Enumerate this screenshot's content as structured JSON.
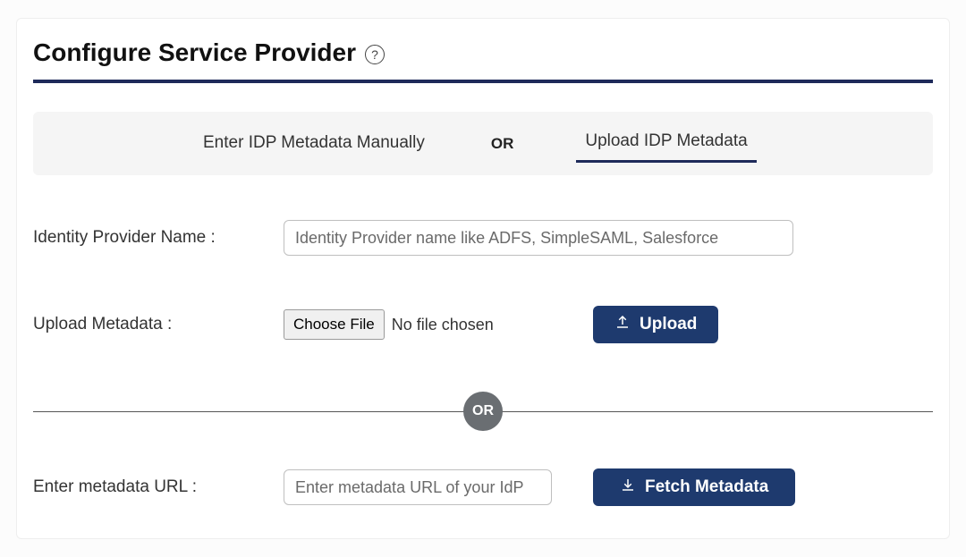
{
  "header": {
    "title": "Configure Service Provider"
  },
  "tabs": {
    "manual": "Enter IDP Metadata Manually",
    "or": "OR",
    "upload": "Upload IDP Metadata"
  },
  "labels": {
    "idp_name": "Identity Provider Name :",
    "upload_metadata": "Upload Metadata :",
    "metadata_url": "Enter metadata URL :"
  },
  "inputs": {
    "idp_name_placeholder": "Identity Provider name like ADFS, SimpleSAML, Salesforce",
    "metadata_url_placeholder": "Enter metadata URL of your IdP"
  },
  "file": {
    "choose_label": "Choose File",
    "status": "No file chosen"
  },
  "buttons": {
    "upload": "Upload",
    "fetch": "Fetch Metadata"
  },
  "divider": {
    "or": "OR"
  }
}
